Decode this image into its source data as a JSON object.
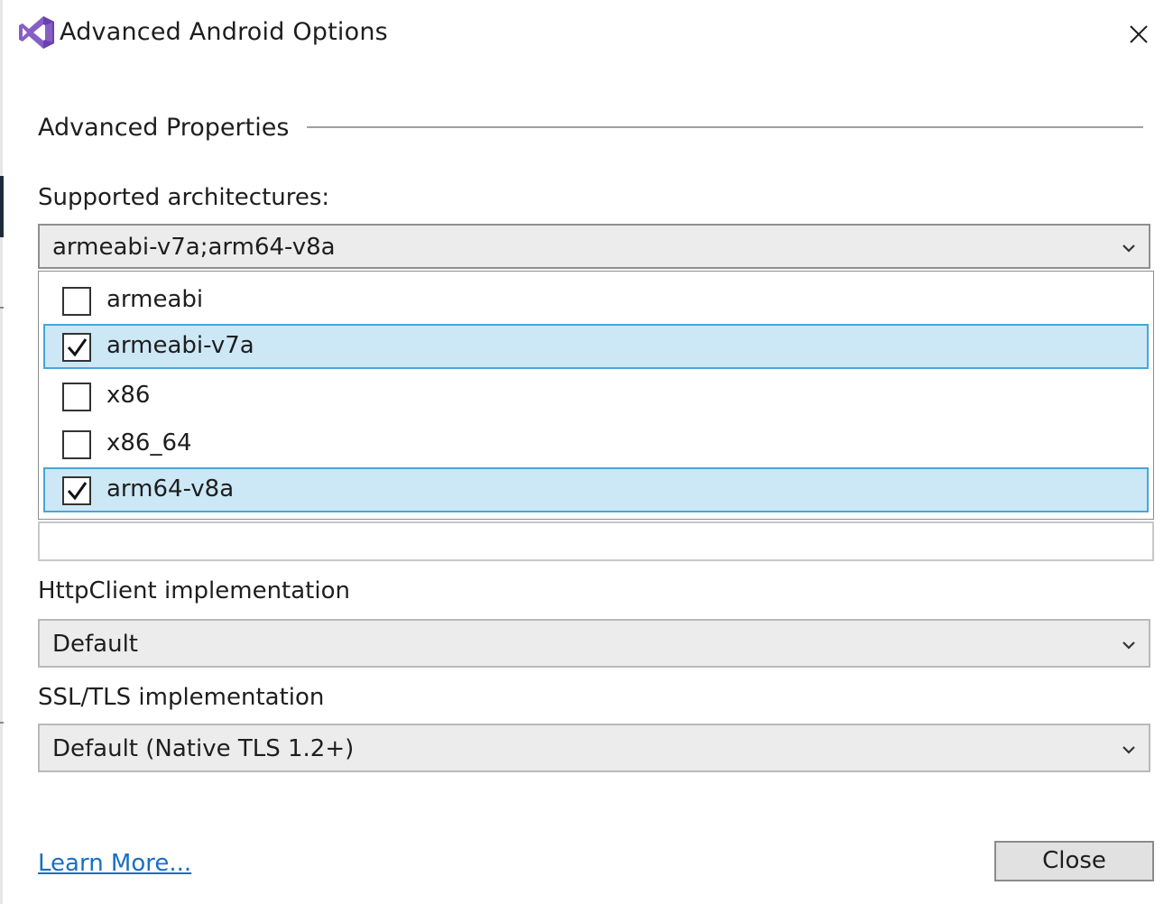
{
  "window": {
    "title": "Advanced Android Options",
    "icon": "visual-studio-logo",
    "close_icon": "close-icon"
  },
  "section": {
    "label": "Advanced Properties"
  },
  "architectures": {
    "label": "Supported architectures:",
    "value": "armeabi-v7a;arm64-v8a",
    "options": [
      {
        "label": "armeabi",
        "checked": false
      },
      {
        "label": "armeabi-v7a",
        "checked": true
      },
      {
        "label": "x86",
        "checked": false
      },
      {
        "label": "x86_64",
        "checked": false
      },
      {
        "label": "arm64-v8a",
        "checked": true
      }
    ]
  },
  "http_client": {
    "label": "HttpClient implementation",
    "value": "Default"
  },
  "ssl_tls": {
    "label": "SSL/TLS implementation",
    "value": "Default (Native TLS 1.2+)"
  },
  "footer": {
    "learn_more": "Learn More...",
    "close_label": "Close"
  },
  "colors": {
    "selection_fill": "#cce8f6",
    "selection_border": "#4aa5d6",
    "link": "#1a6fc1",
    "vs_purple": "#865fc5"
  }
}
